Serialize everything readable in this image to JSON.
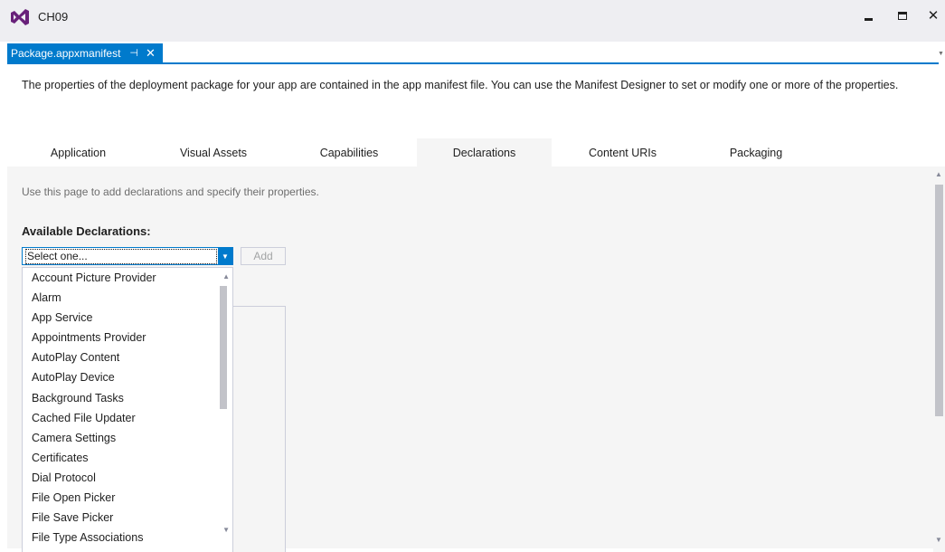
{
  "window": {
    "title": "CH09",
    "logo_icon": "visual-studio-logo-icon",
    "minimize_icon": "minimize-icon",
    "maximize_icon": "maximize-icon",
    "close_glyph": "✕"
  },
  "document_tab": {
    "label": "Package.appxmanifest",
    "pin_glyph": "⊣",
    "close_glyph": "✕",
    "overflow_glyph": "▼"
  },
  "intro_text": "The properties of the deployment package for your app are contained in the app manifest file. You can use the Manifest Designer to set or modify one or more of the properties.",
  "tabs": {
    "application": "Application",
    "visual_assets": "Visual Assets",
    "capabilities": "Capabilities",
    "declarations": "Declarations",
    "content_uris": "Content URIs",
    "packaging": "Packaging",
    "active": "Declarations"
  },
  "declarations_page": {
    "description": "Use this page to add declarations and specify their properties.",
    "available_label": "Available Declarations:",
    "select_value": "Select one...",
    "add_button": "Add",
    "options": [
      "Account Picture Provider",
      "Alarm",
      "App Service",
      "Appointments Provider",
      "AutoPlay Content",
      "AutoPlay Device",
      "Background Tasks",
      "Cached File Updater",
      "Camera Settings",
      "Certificates",
      "Dial Protocol",
      "File Open Picker",
      "File Save Picker",
      "File Type Associations"
    ]
  },
  "colors": {
    "accent": "#007acc",
    "chrome": "#eeeef2",
    "panel": "#f5f5f5",
    "logo": "#68217a"
  }
}
